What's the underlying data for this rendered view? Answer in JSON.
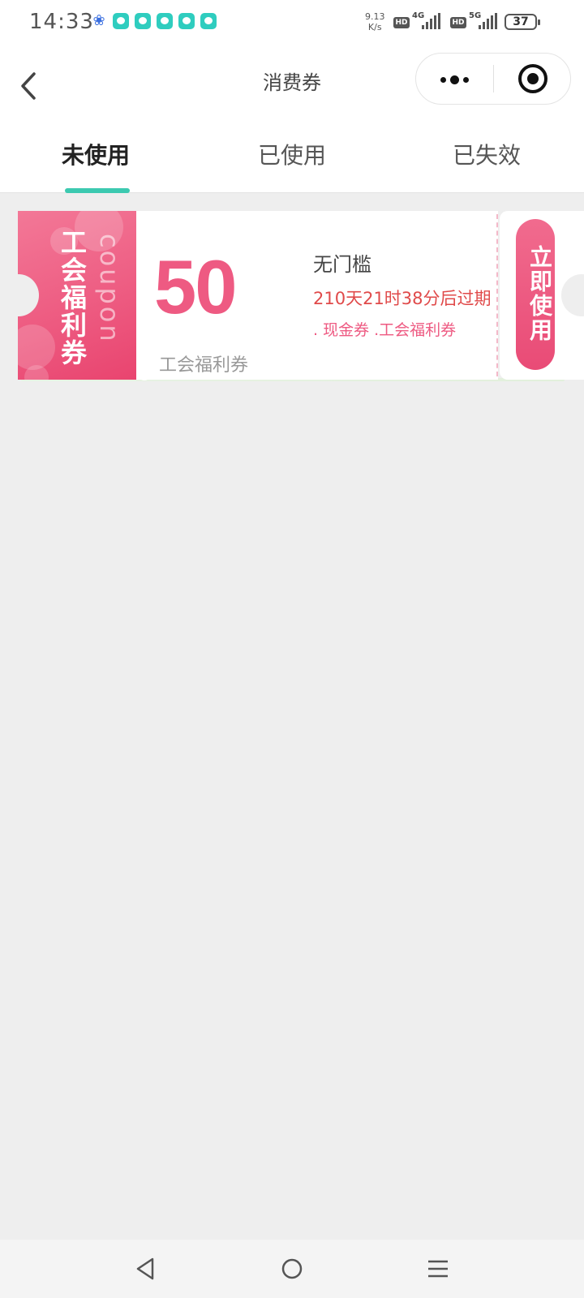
{
  "status_bar": {
    "time": "14:33",
    "net_speed_value": "9.13",
    "net_speed_unit": "K/s",
    "hd1": "HD",
    "net1": "4G",
    "hd2": "HD",
    "net2": "5G",
    "battery": "37",
    "notification_icons": [
      "baidu-icon",
      "chat-icon",
      "chat-icon",
      "chat-icon",
      "chat-icon",
      "chat-icon"
    ]
  },
  "header": {
    "title": "消费券"
  },
  "tabs": [
    {
      "label": "未使用",
      "active": true
    },
    {
      "label": "已使用",
      "active": false
    },
    {
      "label": "已失效",
      "active": false
    }
  ],
  "coupons": [
    {
      "side_label": "工会福利券",
      "side_watermark": "coupon",
      "amount": "50",
      "name": "工会福利券",
      "threshold": "无门槛",
      "expire_text": "210天21时38分后过期",
      "tags": ". 现金券 .工会福利券",
      "use_button": "立即使用"
    }
  ],
  "colors": {
    "accent": "#3cc9b0",
    "coupon_pink": "#ee5a82",
    "expire_red": "#e04a4a",
    "background": "#eeeeee"
  }
}
